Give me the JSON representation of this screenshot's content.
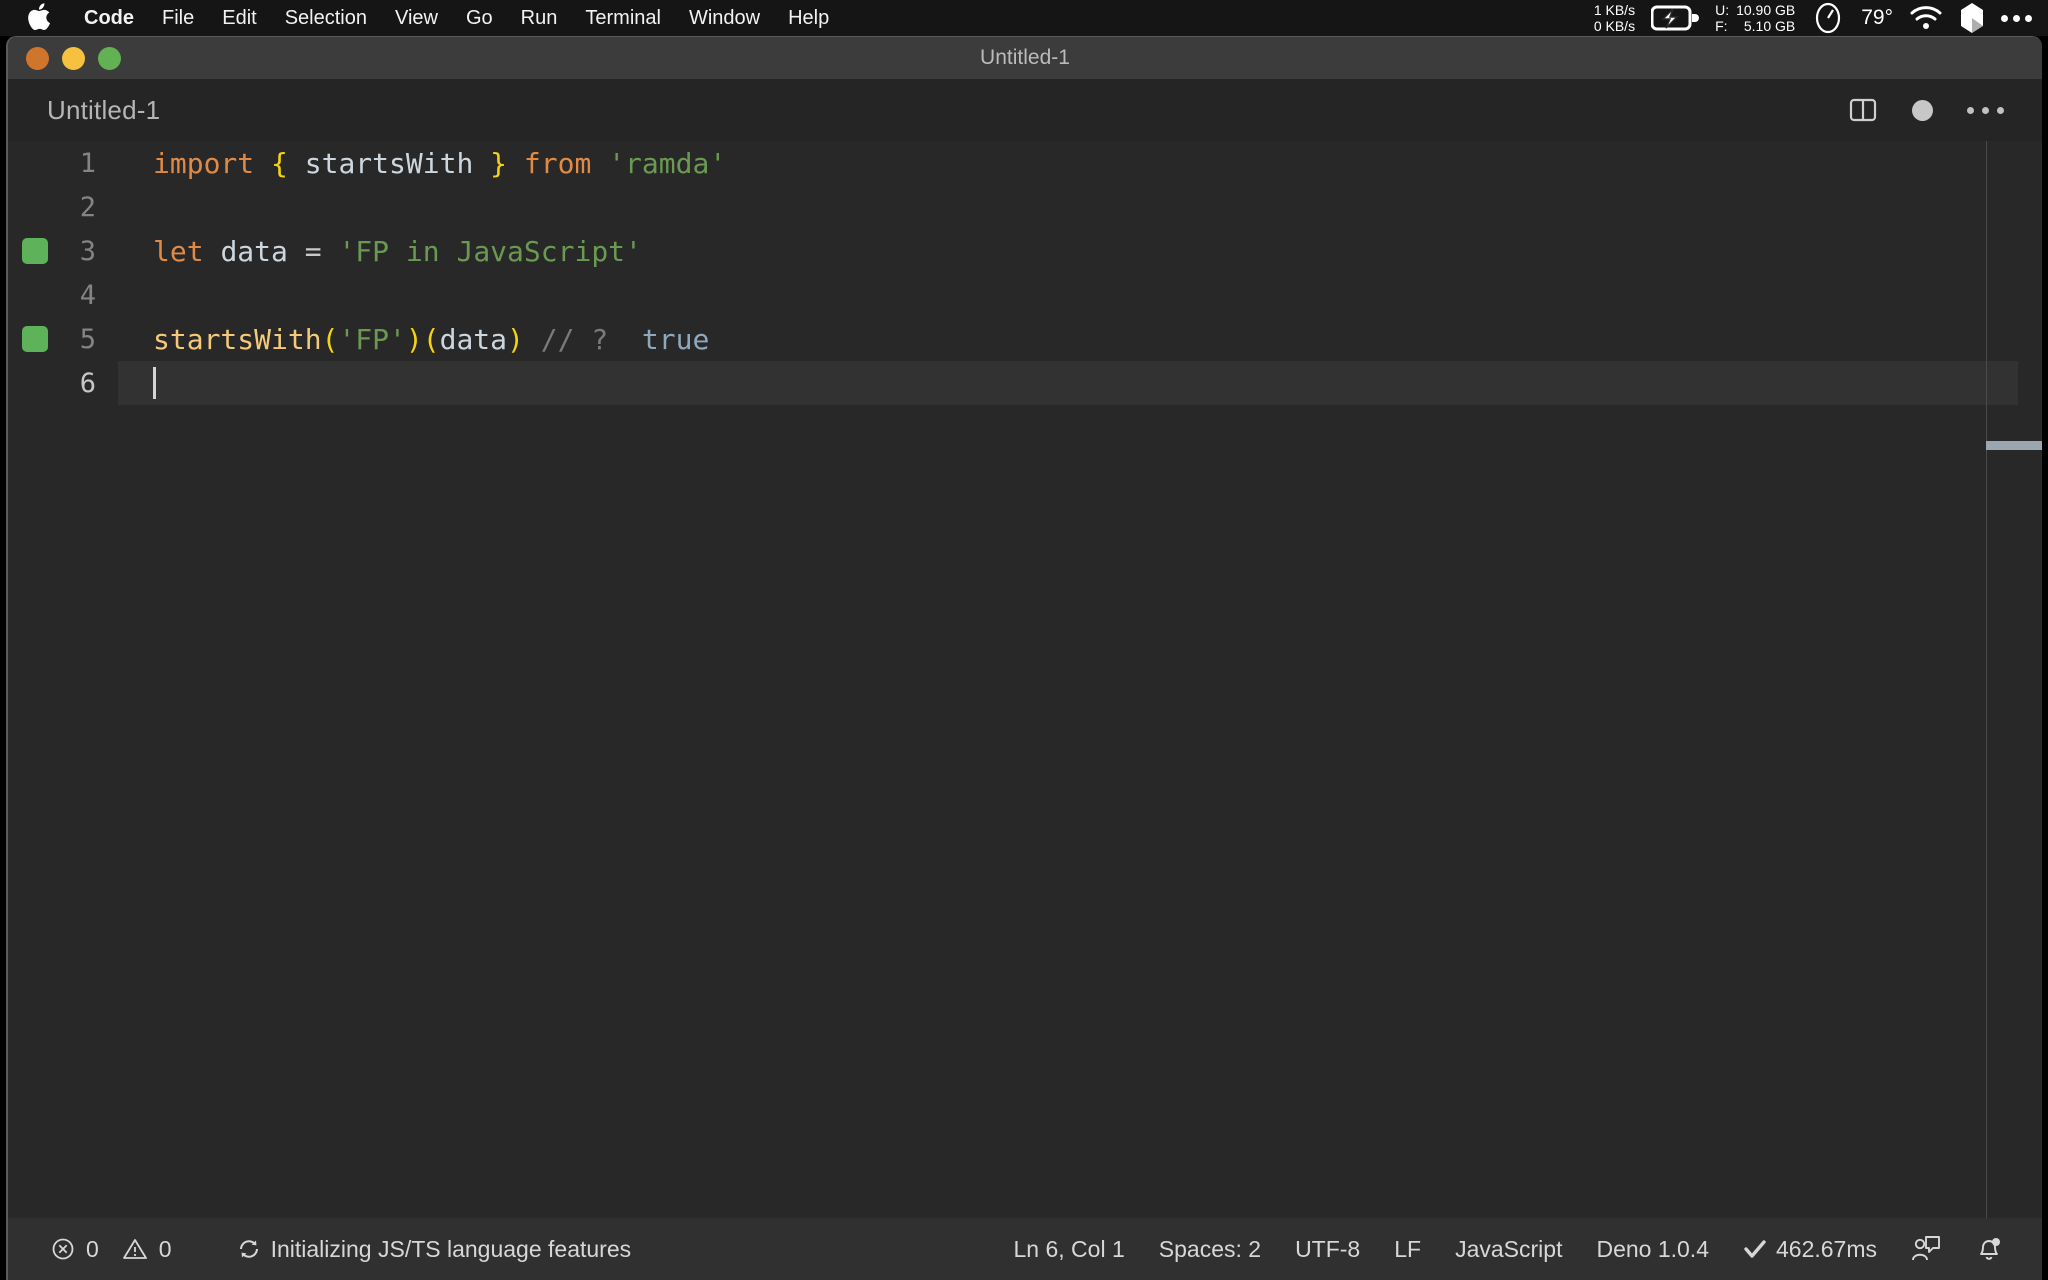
{
  "menubar": {
    "apple_icon": "apple-logo-icon",
    "items": [
      {
        "label": "Code",
        "bold": true
      },
      {
        "label": "File",
        "bold": false
      },
      {
        "label": "Edit",
        "bold": false
      },
      {
        "label": "Selection",
        "bold": false
      },
      {
        "label": "View",
        "bold": false
      },
      {
        "label": "Go",
        "bold": false
      },
      {
        "label": "Run",
        "bold": false
      },
      {
        "label": "Terminal",
        "bold": false
      },
      {
        "label": "Window",
        "bold": false
      },
      {
        "label": "Help",
        "bold": false
      }
    ],
    "status": {
      "net_down": "1 KB/s",
      "net_up": "0 KB/s",
      "battery_icon": "battery-charging-icon",
      "mem_used_label": "U:",
      "mem_free_label": "F:",
      "mem_used_value": "10.90 GB",
      "mem_free_value": "5.10 GB",
      "gauge_icon": "speedometer-icon",
      "temperature": "79°",
      "wifi_icon": "wifi-icon",
      "control_center_icon": "control-center-icon",
      "more_icon": "ellipsis-icon"
    }
  },
  "window": {
    "title": "Untitled-1",
    "traffic_lights": [
      "close-button",
      "minimize-button",
      "maximize-button"
    ]
  },
  "editor": {
    "tab_label": "Untitled-1",
    "actions": {
      "split_editor": "split-editor-icon",
      "dirty_indicator": "unsaved-changes-dot",
      "more_actions": "more-actions-icon"
    },
    "lines": [
      {
        "number": "1",
        "modified": false,
        "active": false,
        "tokens": [
          {
            "text": "import",
            "type": "key"
          },
          {
            "text": " ",
            "type": "plain"
          },
          {
            "text": "{",
            "type": "brace"
          },
          {
            "text": " ",
            "type": "plain"
          },
          {
            "text": "startsWith",
            "type": "var"
          },
          {
            "text": " ",
            "type": "plain"
          },
          {
            "text": "}",
            "type": "brace"
          },
          {
            "text": " ",
            "type": "plain"
          },
          {
            "text": "from",
            "type": "key"
          },
          {
            "text": " ",
            "type": "plain"
          },
          {
            "text": "'ramda'",
            "type": "str"
          }
        ]
      },
      {
        "number": "2",
        "modified": false,
        "active": false,
        "tokens": []
      },
      {
        "number": "3",
        "modified": true,
        "active": false,
        "tokens": [
          {
            "text": "let",
            "type": "key"
          },
          {
            "text": " ",
            "type": "plain"
          },
          {
            "text": "data",
            "type": "var"
          },
          {
            "text": " ",
            "type": "plain"
          },
          {
            "text": "=",
            "type": "op"
          },
          {
            "text": " ",
            "type": "plain"
          },
          {
            "text": "'FP in JavaScript'",
            "type": "str"
          }
        ]
      },
      {
        "number": "4",
        "modified": false,
        "active": false,
        "tokens": []
      },
      {
        "number": "5",
        "modified": true,
        "active": false,
        "tokens": [
          {
            "text": "startsWith",
            "type": "fn"
          },
          {
            "text": "(",
            "type": "paren"
          },
          {
            "text": "'FP'",
            "type": "str"
          },
          {
            "text": ")",
            "type": "paren"
          },
          {
            "text": "(",
            "type": "paren"
          },
          {
            "text": "data",
            "type": "var"
          },
          {
            "text": ")",
            "type": "paren"
          },
          {
            "text": " ",
            "type": "plain"
          },
          {
            "text": "// ?",
            "type": "comment"
          },
          {
            "text": "  ",
            "type": "plain"
          },
          {
            "text": "true",
            "type": "bool"
          }
        ]
      },
      {
        "number": "6",
        "modified": false,
        "active": true,
        "tokens": []
      }
    ]
  },
  "statusbar": {
    "errors_icon": "error-circle-icon",
    "errors_count": "0",
    "warnings_icon": "warning-triangle-icon",
    "warnings_count": "0",
    "sync_icon": "sync-spinner-icon",
    "task_text": "Initializing JS/TS language features",
    "cursor_position": "Ln 6, Col 1",
    "indentation": "Spaces: 2",
    "encoding": "UTF-8",
    "eol": "LF",
    "language": "JavaScript",
    "runtime": "Deno 1.0.4",
    "timing_icon": "check-icon",
    "timing": "462.67ms",
    "feedback_icon": "feedback-person-icon",
    "notifications_icon": "bell-icon"
  },
  "colors": {
    "menubar_bg": "#151515",
    "titlebar_bg": "#3c3c3c",
    "editor_bg": "#282828",
    "tabbar_bg": "#252526",
    "statusbar_bg": "#303031",
    "keyword": "#e08a45",
    "string": "#6a9a52",
    "brace": "#f5d312",
    "function": "#f5c97a",
    "boolean": "#8fa8bd",
    "comment": "#7a7a7a",
    "git_added": "#5eb35a"
  }
}
